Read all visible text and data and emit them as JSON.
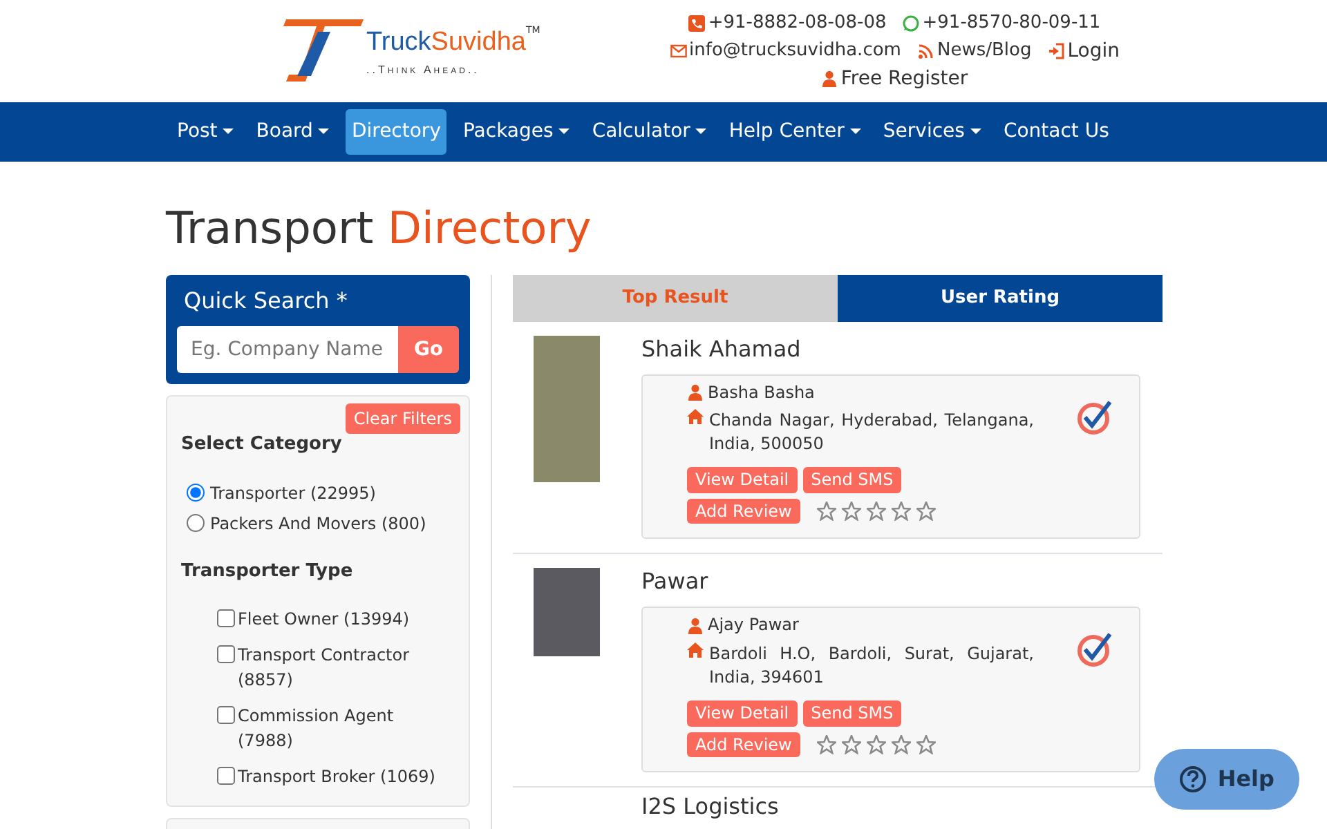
{
  "header": {
    "logo": {
      "name_first": "Truck",
      "name_second": "Suvidha",
      "trademark": "TM",
      "tagline": "..Think Ahead.."
    },
    "contact_lines": [
      [
        {
          "kind": "phone",
          "text": "+91-8882-08-08-08"
        },
        {
          "kind": "whatsapp",
          "text": "+91-8570-80-09-11"
        }
      ],
      [
        {
          "kind": "email",
          "text": "info@trucksuvidha.com"
        },
        {
          "kind": "rss",
          "text": "News/Blog"
        },
        {
          "kind": "login",
          "text": "Login"
        }
      ],
      [
        {
          "kind": "user",
          "text": "Free Register"
        }
      ]
    ]
  },
  "nav": [
    {
      "label": "Post",
      "dropdown": true,
      "selected": false
    },
    {
      "label": "Board",
      "dropdown": true,
      "selected": false
    },
    {
      "label": "Directory",
      "dropdown": false,
      "selected": true
    },
    {
      "label": "Packages",
      "dropdown": true,
      "selected": false
    },
    {
      "label": "Calculator",
      "dropdown": true,
      "selected": false
    },
    {
      "label": "Help Center",
      "dropdown": true,
      "selected": false
    },
    {
      "label": "Services",
      "dropdown": true,
      "selected": false
    },
    {
      "label": "Contact Us",
      "dropdown": false,
      "selected": false
    }
  ],
  "page_title": {
    "main": "Transport",
    "highlight": "Directory"
  },
  "quick_search": {
    "title": "Quick Search *",
    "placeholder": "Eg. Company Name",
    "button": "Go"
  },
  "filters": {
    "clear_button": "Clear Filters",
    "category_title": "Select Category",
    "categories": [
      {
        "label": "Transporter (22995)",
        "selected": true
      },
      {
        "label": "Packers And Movers (800)",
        "selected": false
      }
    ],
    "type_title": "Transporter Type",
    "types": [
      {
        "label": "Fleet Owner (13994)",
        "checked": false
      },
      {
        "label": "Transport Contractor (8857)",
        "checked": false
      },
      {
        "label": "Commission Agent (7988)",
        "checked": false
      },
      {
        "label": "Transport Broker (1069)",
        "checked": false
      }
    ]
  },
  "tabs": [
    {
      "label": "Top Result",
      "selected": true
    },
    {
      "label": "User Rating",
      "selected": false
    }
  ],
  "results": [
    {
      "name": "Shaik Ahamad",
      "contact": "Basha Basha",
      "address": "Chanda Nagar, Hyderabad, Telangana, India, 500050",
      "verified": true,
      "stars": 0,
      "buttons": [
        "View Detail",
        "Send SMS",
        "Add Review"
      ]
    },
    {
      "name": "Pawar",
      "contact": "Ajay Pawar",
      "address": "Bardoli H.O, Bardoli, Surat, Gujarat, India, 394601",
      "verified": true,
      "stars": 0,
      "buttons": [
        "View Detail",
        "Send SMS",
        "Add Review"
      ]
    }
  ],
  "partial_result": {
    "name": "I2S Logistics"
  },
  "help_button": "Help"
}
